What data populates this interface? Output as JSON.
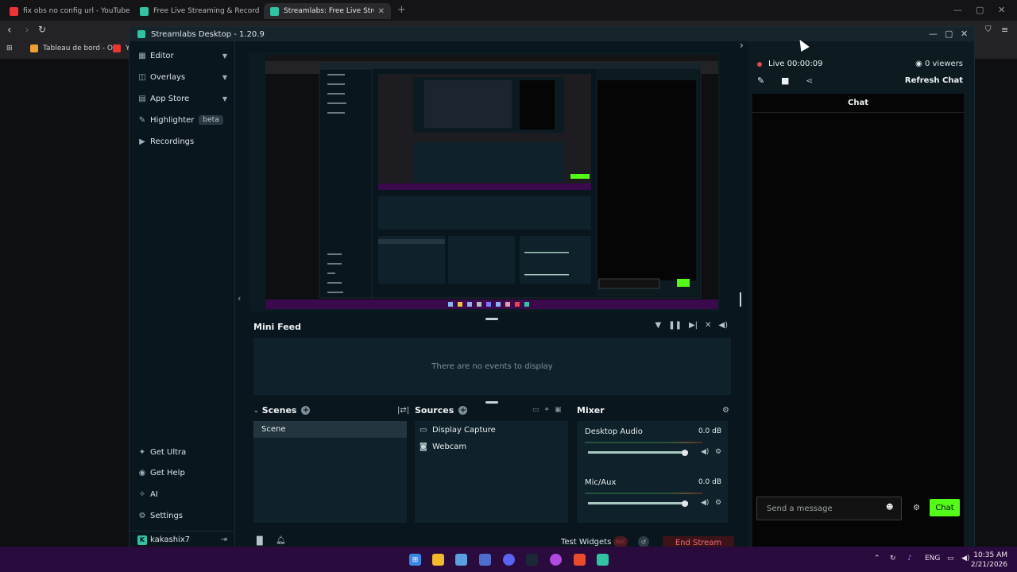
{
  "browser": {
    "tabs": [
      {
        "title": "fix obs no config url - YouTube"
      },
      {
        "title": "Free Live Streaming & Recording Sof"
      },
      {
        "title": "Streamlabs: Free Live Streaming"
      }
    ],
    "bookmarks": [
      {
        "label": "Tableau de bord - O..."
      },
      {
        "label": "Y"
      }
    ]
  },
  "app": {
    "title": "Streamlabs Desktop - 1.20.9",
    "sidebar": {
      "items": [
        {
          "label": "Editor"
        },
        {
          "label": "Overlays"
        },
        {
          "label": "App Store"
        },
        {
          "label": "Highlighter",
          "badge": "beta"
        },
        {
          "label": "Recordings"
        }
      ],
      "bottom": [
        {
          "label": "Get Ultra"
        },
        {
          "label": "Get Help"
        },
        {
          "label": "AI"
        },
        {
          "label": "Settings"
        },
        {
          "label": "kakashix7"
        }
      ]
    },
    "minifeed": {
      "title": "Mini Feed",
      "empty": "There are no events to display"
    },
    "scenes": {
      "title": "Scenes",
      "items": [
        {
          "label": "Scene"
        }
      ]
    },
    "sources": {
      "title": "Sources",
      "items": [
        {
          "label": "Display Capture"
        },
        {
          "label": "Webcam"
        }
      ]
    },
    "mixer": {
      "title": "Mixer",
      "channels": [
        {
          "label": "Desktop Audio",
          "db": "0.0 dB",
          "volume": 0.97
        },
        {
          "label": "Mic/Aux",
          "db": "0.0 dB",
          "volume": 0.97
        }
      ]
    },
    "footer": {
      "test_widgets": "Test Widgets",
      "end_stream": "End Stream"
    },
    "chat": {
      "live": "Live 00:00:09",
      "viewers": "0 viewers",
      "refresh": "Refresh Chat",
      "header": "Chat",
      "placeholder": "Send a message",
      "send": "Chat"
    }
  },
  "taskbar": {
    "lang": "ENG",
    "time": "10:35 AM",
    "date": "2/21/2026"
  }
}
